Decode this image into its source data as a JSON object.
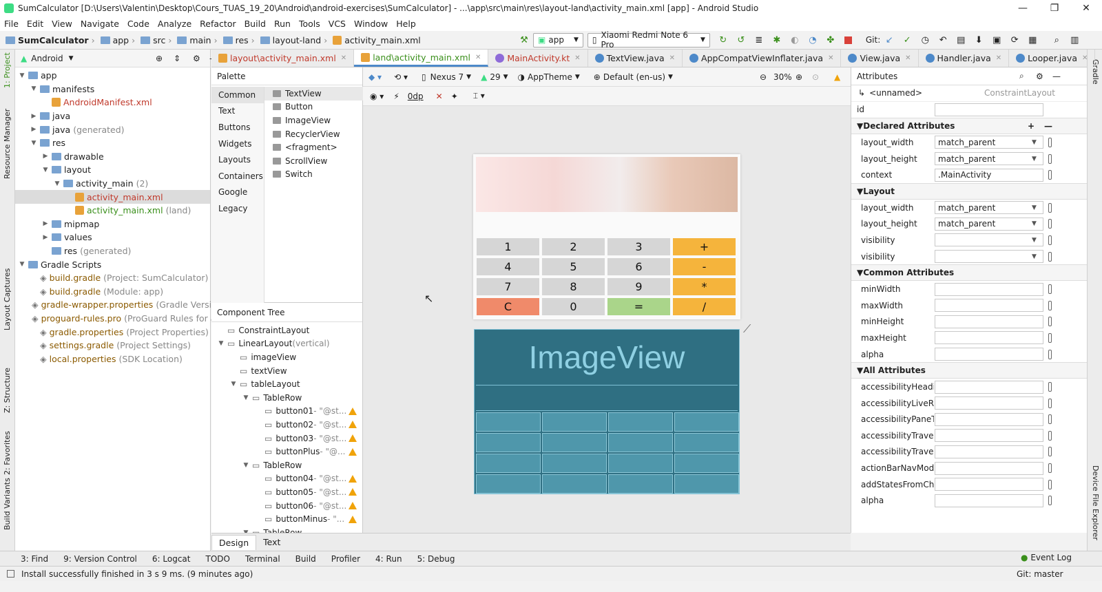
{
  "window": {
    "title": "SumCalculator [D:\\Users\\Valentin\\Desktop\\Cours_TUAS_19_20\\Android\\android-exercises\\SumCalculator] - ...\\app\\src\\main\\res\\layout-land\\activity_main.xml [app] - Android Studio",
    "minimize": "—",
    "maximize": "❐",
    "close": "✕"
  },
  "menu": [
    "File",
    "Edit",
    "View",
    "Navigate",
    "Code",
    "Analyze",
    "Refactor",
    "Build",
    "Run",
    "Tools",
    "VCS",
    "Window",
    "Help"
  ],
  "breadcrumbs": [
    "SumCalculator",
    "app",
    "src",
    "main",
    "res",
    "layout-land",
    "activity_main.xml"
  ],
  "toolbar": {
    "module": "app",
    "device": "Xiaomi Redmi Note 6 Pro",
    "git_label": "Git:"
  },
  "left_strip": [
    "1: Project",
    "Resource Manager",
    "Layout Captures",
    "Z: Structure",
    "2: Favorites",
    "Build Variants"
  ],
  "right_strip": [
    "Gradle",
    "Device File Explorer"
  ],
  "project": {
    "view": "Android",
    "tree": [
      {
        "label": "app",
        "extra": "",
        "level": 0,
        "type": "folder",
        "open": true
      },
      {
        "label": "manifests",
        "extra": "",
        "level": 1,
        "type": "folder",
        "open": true
      },
      {
        "label": "AndroidManifest.xml",
        "extra": "",
        "level": 2,
        "type": "file-red"
      },
      {
        "label": "java",
        "extra": "",
        "level": 1,
        "type": "folder",
        "open": false
      },
      {
        "label": "java",
        "extra": "(generated)",
        "level": 1,
        "type": "folder",
        "open": false
      },
      {
        "label": "res",
        "extra": "",
        "level": 1,
        "type": "folder",
        "open": true
      },
      {
        "label": "drawable",
        "extra": "",
        "level": 2,
        "type": "folder",
        "open": false
      },
      {
        "label": "layout",
        "extra": "",
        "level": 2,
        "type": "folder",
        "open": true
      },
      {
        "label": "activity_main",
        "extra": "(2)",
        "level": 3,
        "type": "folder",
        "open": true
      },
      {
        "label": "activity_main.xml",
        "extra": "",
        "level": 4,
        "type": "file-red",
        "selected": true
      },
      {
        "label": "activity_main.xml",
        "extra": "(land)",
        "level": 4,
        "type": "file-green"
      },
      {
        "label": "mipmap",
        "extra": "",
        "level": 2,
        "type": "folder",
        "open": false
      },
      {
        "label": "values",
        "extra": "",
        "level": 2,
        "type": "folder",
        "open": false
      },
      {
        "label": "res",
        "extra": "(generated)",
        "level": 2,
        "type": "folder-leaf"
      },
      {
        "label": "Gradle Scripts",
        "extra": "",
        "level": 0,
        "type": "folder",
        "open": true
      },
      {
        "label": "build.gradle",
        "extra": "(Project: SumCalculator)",
        "level": 1,
        "type": "file-brown"
      },
      {
        "label": "build.gradle",
        "extra": "(Module: app)",
        "level": 1,
        "type": "file-brown"
      },
      {
        "label": "gradle-wrapper.properties",
        "extra": "(Gradle Version)",
        "level": 1,
        "type": "file-brown"
      },
      {
        "label": "proguard-rules.pro",
        "extra": "(ProGuard Rules for app)",
        "level": 1,
        "type": "file-brown"
      },
      {
        "label": "gradle.properties",
        "extra": "(Project Properties)",
        "level": 1,
        "type": "file-brown"
      },
      {
        "label": "settings.gradle",
        "extra": "(Project Settings)",
        "level": 1,
        "type": "file-brown"
      },
      {
        "label": "local.properties",
        "extra": "(SDK Location)",
        "level": 1,
        "type": "file-brown"
      }
    ]
  },
  "editor_tabs": [
    {
      "label": "layout\\activity_main.xml",
      "active": false,
      "color": "#c0392b"
    },
    {
      "label": "land\\activity_main.xml",
      "active": true,
      "color": "#3a8f1b"
    },
    {
      "label": "MainActivity.kt",
      "active": false,
      "color": "#c0392b"
    },
    {
      "label": "TextView.java",
      "active": false,
      "color": "#222"
    },
    {
      "label": "AppCompatViewInflater.java",
      "active": false,
      "color": "#222"
    },
    {
      "label": "View.java",
      "active": false,
      "color": "#222"
    },
    {
      "label": "Handler.java",
      "active": false,
      "color": "#222"
    },
    {
      "label": "Looper.java",
      "active": false,
      "color": "#222"
    }
  ],
  "palette": {
    "title": "Palette",
    "categories": [
      "Common",
      "Text",
      "Buttons",
      "Widgets",
      "Layouts",
      "Containers",
      "Google",
      "Legacy"
    ],
    "items": [
      "TextView",
      "Button",
      "ImageView",
      "RecyclerView",
      "<fragment>",
      "ScrollView",
      "Switch"
    ]
  },
  "design_toolbar": {
    "device": "Nexus 7",
    "api": "29",
    "theme": "AppTheme",
    "locale": "Default (en-us)",
    "zoom": "30%",
    "margin": "0dp"
  },
  "component_tree": {
    "title": "Component Tree",
    "items": [
      {
        "label": "ConstraintLayout",
        "extra": "",
        "level": 0,
        "warn": false
      },
      {
        "label": "LinearLayout",
        "extra": "(vertical)",
        "level": 0,
        "warn": false,
        "open": true
      },
      {
        "label": "imageView",
        "extra": "",
        "level": 1,
        "warn": false
      },
      {
        "label": "textView",
        "extra": "",
        "level": 1,
        "warn": false
      },
      {
        "label": "tableLayout",
        "extra": "",
        "level": 1,
        "warn": false,
        "open": true
      },
      {
        "label": "TableRow",
        "extra": "",
        "level": 2,
        "warn": false,
        "open": true
      },
      {
        "label": "button01",
        "extra": "- \"@st...",
        "level": 3,
        "warn": true
      },
      {
        "label": "button02",
        "extra": "- \"@st...",
        "level": 3,
        "warn": true
      },
      {
        "label": "button03",
        "extra": "- \"@st...",
        "level": 3,
        "warn": true
      },
      {
        "label": "buttonPlus",
        "extra": "- \"@...",
        "level": 3,
        "warn": true
      },
      {
        "label": "TableRow",
        "extra": "",
        "level": 2,
        "warn": false,
        "open": true
      },
      {
        "label": "button04",
        "extra": "- \"@st...",
        "level": 3,
        "warn": true
      },
      {
        "label": "button05",
        "extra": "- \"@st...",
        "level": 3,
        "warn": true
      },
      {
        "label": "button06",
        "extra": "- \"@st...",
        "level": 3,
        "warn": true
      },
      {
        "label": "buttonMinus",
        "extra": "- \"...",
        "level": 3,
        "warn": true
      },
      {
        "label": "TableRow",
        "extra": "",
        "level": 2,
        "warn": false,
        "open": true
      }
    ]
  },
  "keypad": [
    {
      "label": "1",
      "kind": "num"
    },
    {
      "label": "2",
      "kind": "num"
    },
    {
      "label": "3",
      "kind": "num"
    },
    {
      "label": "+",
      "kind": "op"
    },
    {
      "label": "4",
      "kind": "num"
    },
    {
      "label": "5",
      "kind": "num"
    },
    {
      "label": "6",
      "kind": "num"
    },
    {
      "label": "-",
      "kind": "op"
    },
    {
      "label": "7",
      "kind": "num"
    },
    {
      "label": "8",
      "kind": "num"
    },
    {
      "label": "9",
      "kind": "num"
    },
    {
      "label": "*",
      "kind": "op"
    },
    {
      "label": "C",
      "kind": "c"
    },
    {
      "label": "0",
      "kind": "num"
    },
    {
      "label": "=",
      "kind": "eq"
    },
    {
      "label": "/",
      "kind": "op"
    }
  ],
  "blueprint_label": "ImageView",
  "attributes": {
    "title": "Attributes",
    "component": "<unnamed>",
    "component_type": "ConstraintLayout",
    "id_label": "id",
    "declared_title": "Declared Attributes",
    "declared": [
      {
        "k": "layout_width",
        "v": "match_parent",
        "dd": true
      },
      {
        "k": "layout_height",
        "v": "match_parent",
        "dd": true
      },
      {
        "k": "context",
        "v": ".MainActivity",
        "dd": false
      }
    ],
    "layout_title": "Layout",
    "layout": [
      {
        "k": "layout_width",
        "v": "match_parent",
        "dd": true
      },
      {
        "k": "layout_height",
        "v": "match_parent",
        "dd": true
      },
      {
        "k": "visibility",
        "v": "",
        "dd": true
      },
      {
        "k": "visibility",
        "v": "",
        "dd": true
      }
    ],
    "common_title": "Common Attributes",
    "common": [
      {
        "k": "minWidth",
        "v": ""
      },
      {
        "k": "maxWidth",
        "v": ""
      },
      {
        "k": "minHeight",
        "v": ""
      },
      {
        "k": "maxHeight",
        "v": ""
      },
      {
        "k": "alpha",
        "v": ""
      }
    ],
    "all_title": "All Attributes",
    "all": [
      {
        "k": "accessibilityHeading",
        "v": ""
      },
      {
        "k": "accessibilityLiveRegic",
        "v": ""
      },
      {
        "k": "accessibilityPaneTitle",
        "v": ""
      },
      {
        "k": "accessibilityTraversal",
        "v": ""
      },
      {
        "k": "accessibilityTraversall",
        "v": ""
      },
      {
        "k": "actionBarNavMode",
        "v": ""
      },
      {
        "k": "addStatesFromChildr",
        "v": ""
      },
      {
        "k": "alpha",
        "v": ""
      }
    ]
  },
  "bottom_tabs": [
    "Design",
    "Text"
  ],
  "tool_windows": [
    "3: Find",
    "9: Version Control",
    "6: Logcat",
    "TODO",
    "Terminal",
    "Build",
    "Profiler",
    "4: Run",
    "5: Debug"
  ],
  "event_log": "Event Log",
  "status": {
    "message": "Install successfully finished in 3 s 9 ms. (9 minutes ago)",
    "git": "Git: master"
  }
}
